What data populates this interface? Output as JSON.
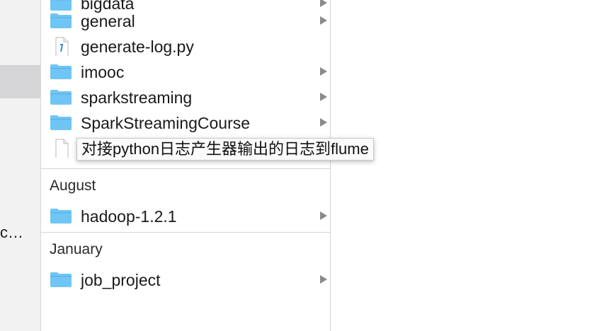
{
  "sidebar": {
    "truncated_item": "c…"
  },
  "column": {
    "items": [
      {
        "label": "bigdata",
        "type": "folder",
        "has_children": true
      },
      {
        "label": "general",
        "type": "folder",
        "has_children": true
      },
      {
        "label": "generate-log.py",
        "type": "python-file",
        "has_children": false
      },
      {
        "label": "imooc",
        "type": "folder",
        "has_children": true
      },
      {
        "label": "sparkstreaming",
        "type": "folder",
        "has_children": true
      },
      {
        "label": "SparkStreamingCourse",
        "type": "folder",
        "has_children": true
      },
      {
        "label": "对接python日志产生器输出的日志到flume",
        "type": "document",
        "has_children": false
      }
    ],
    "sections": [
      {
        "header": "August",
        "items": [
          {
            "label": "hadoop-1.2.1",
            "type": "folder",
            "has_children": true
          }
        ]
      },
      {
        "header": "January",
        "items": [
          {
            "label": "job_project",
            "type": "folder",
            "has_children": true
          }
        ]
      }
    ]
  },
  "tooltip": {
    "text": "对接python日志产生器输出的日志到flume"
  },
  "colors": {
    "folder_fill": "#6fc6f5",
    "folder_tab": "#5cb4ea",
    "sidebar_bg": "#f2f2f3",
    "sidebar_selected": "#d5d5d8",
    "chevron": "#8a8a8a"
  }
}
